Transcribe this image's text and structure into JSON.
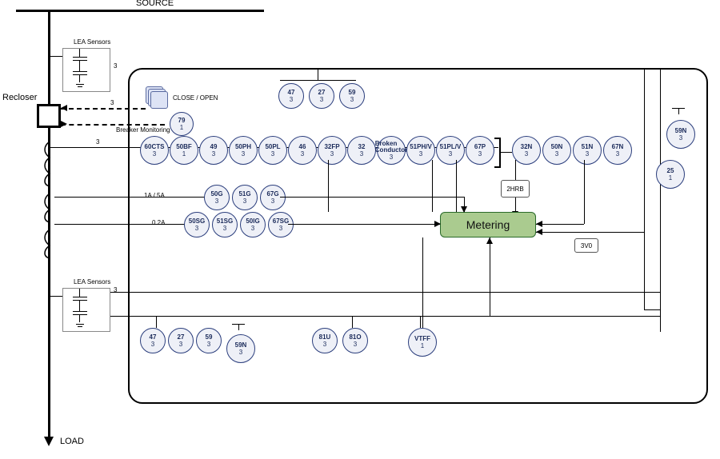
{
  "labels": {
    "source": "SOURCE",
    "load": "LOAD",
    "recloser": "Recloser",
    "lea_sensors": "LEA Sensors",
    "close_open": "CLOSE / OPEN",
    "breaker_monitoring": "Breaker Monitoring",
    "rating_1a5a": "1A / 5A",
    "rating_02a": "0.2A",
    "three": "3",
    "metering": "Metering",
    "hrb": "2HRB",
    "v3v0": "3V0"
  },
  "top_row_volts": [
    {
      "name": "47",
      "cnt": "3"
    },
    {
      "name": "27",
      "cnt": "3"
    },
    {
      "name": "59",
      "cnt": "3"
    }
  ],
  "row1": [
    {
      "name": "60CTS",
      "cnt": "3"
    },
    {
      "name": "50BF",
      "cnt": "1"
    },
    {
      "name": "49",
      "cnt": "3"
    },
    {
      "name": "50PH",
      "cnt": "3"
    },
    {
      "name": "50PL",
      "cnt": "3"
    },
    {
      "name": "46",
      "cnt": "3"
    },
    {
      "name": "32FP",
      "cnt": "3"
    },
    {
      "name": "32",
      "cnt": "3"
    },
    {
      "name": "Broken Conductor",
      "cnt": "3"
    },
    {
      "name": "51PH/V",
      "cnt": "3"
    },
    {
      "name": "51PL/V",
      "cnt": "3"
    },
    {
      "name": "67P",
      "cnt": "3"
    }
  ],
  "row1_neutral": [
    {
      "name": "32N",
      "cnt": "3"
    },
    {
      "name": "50N",
      "cnt": "3"
    },
    {
      "name": "51N",
      "cnt": "3"
    },
    {
      "name": "67N",
      "cnt": "3"
    }
  ],
  "node79": {
    "name": "79",
    "cnt": "1"
  },
  "node25": {
    "name": "25",
    "cnt": "1"
  },
  "node59N_top": {
    "name": "59N",
    "cnt": "3"
  },
  "row_g": [
    {
      "name": "50G",
      "cnt": "3"
    },
    {
      "name": "51G",
      "cnt": "3"
    },
    {
      "name": "67G",
      "cnt": "3"
    }
  ],
  "row_sg": [
    {
      "name": "50SG",
      "cnt": "3"
    },
    {
      "name": "51SG",
      "cnt": "3"
    },
    {
      "name": "50IG",
      "cnt": "3"
    },
    {
      "name": "67SG",
      "cnt": "3"
    }
  ],
  "bottom_volts_left": [
    {
      "name": "47",
      "cnt": "3"
    },
    {
      "name": "27",
      "cnt": "3"
    },
    {
      "name": "59",
      "cnt": "3"
    }
  ],
  "node59N_bottom": {
    "name": "59N",
    "cnt": "3"
  },
  "bottom_freq": [
    {
      "name": "81U",
      "cnt": "3"
    },
    {
      "name": "81O",
      "cnt": "3"
    }
  ],
  "nodeVTFF": {
    "name": "VTFF",
    "cnt": "1"
  }
}
